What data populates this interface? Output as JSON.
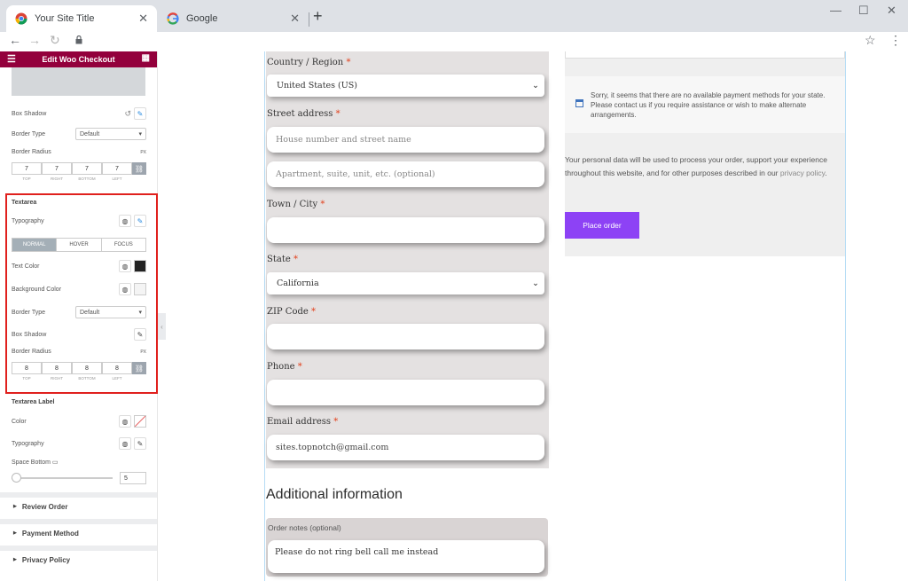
{
  "browser": {
    "tabs": [
      {
        "title": "Your Site Title",
        "close": "✕"
      },
      {
        "title": "Google",
        "close": "✕"
      }
    ],
    "new_tab": "+",
    "window_controls": {
      "minimize": "—",
      "maximize": "☐",
      "close": "✕"
    },
    "nav": {
      "back": "←",
      "forward": "→",
      "reload": "↻"
    }
  },
  "panel": {
    "header_title": "Edit Woo Checkout",
    "box_shadow_label": "Box Shadow",
    "border_type_label": "Border Type",
    "border_type_value": "Default",
    "border_radius_label": "Border Radius",
    "unit": "PX",
    "radius_values": [
      "7",
      "7",
      "7",
      "7"
    ],
    "dim_captions": [
      "TOP",
      "RIGHT",
      "BOTTOM",
      "LEFT"
    ],
    "textarea": {
      "title": "Textarea",
      "typography_label": "Typography",
      "state_tabs": [
        "NORMAL",
        "HOVER",
        "FOCUS"
      ],
      "text_color_label": "Text Color",
      "text_color": "#222222",
      "bg_color_label": "Background Color",
      "border_type_label": "Border Type",
      "border_type_value": "Default",
      "box_shadow_label": "Box Shadow",
      "border_radius_label": "Border Radius",
      "unit": "PX",
      "radius_values": [
        "8",
        "8",
        "8",
        "8"
      ]
    },
    "textarea_label": {
      "title": "Textarea Label",
      "color_label": "Color",
      "typography_label": "Typography",
      "space_bottom_label": "Space Bottom",
      "space_bottom_value": "5"
    },
    "accordions": [
      "Review Order",
      "Payment Method",
      "Privacy Policy"
    ]
  },
  "form": {
    "country_label": "Country / Region",
    "country_value": "United States (US)",
    "street_label": "Street address",
    "street_placeholder": "House number and street name",
    "street2_placeholder": "Apartment, suite, unit, etc. (optional)",
    "city_label": "Town / City",
    "state_label": "State",
    "state_value": "California",
    "zip_label": "ZIP Code",
    "phone_label": "Phone",
    "email_label": "Email address",
    "email_value": "sites.topnotch@gmail.com",
    "required_mark": "*",
    "additional_heading": "Additional information",
    "notes_label": "Order notes (optional)",
    "notes_value": "Please do not ring bell call me instead"
  },
  "review": {
    "notice": "Sorry, it seems that there are no available payment methods for your state. Please contact us if you require assistance or wish to make alternate arrangements.",
    "privacy_text": "Your personal data will be used to process your order, support your experience throughout this website, and for other purposes described in our ",
    "privacy_link": "privacy policy",
    "privacy_end": ".",
    "place_order": "Place order",
    "button_color": "#8d42f5"
  }
}
